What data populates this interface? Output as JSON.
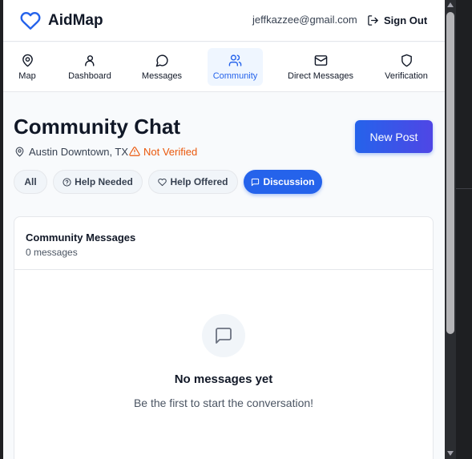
{
  "header": {
    "app_name": "AidMap",
    "user_email": "jeffkazzee@gmail.com",
    "sign_out_label": "Sign Out"
  },
  "nav": {
    "items": [
      {
        "label": "Map",
        "icon": "map-pin-icon"
      },
      {
        "label": "Dashboard",
        "icon": "user-icon"
      },
      {
        "label": "Messages",
        "icon": "message-circle-icon"
      },
      {
        "label": "Community",
        "icon": "users-icon",
        "active": true
      },
      {
        "label": "Direct Messages",
        "icon": "mail-icon"
      },
      {
        "label": "Verification",
        "icon": "shield-icon"
      }
    ]
  },
  "page": {
    "title": "Community Chat",
    "location": "Austin Downtown, TX",
    "verification_status": "Not Verified",
    "new_post_label": "New Post"
  },
  "filters": {
    "items": [
      {
        "label": "All"
      },
      {
        "label": "Help Needed",
        "icon": "help-circle-icon"
      },
      {
        "label": "Help Offered",
        "icon": "heart-icon"
      },
      {
        "label": "Discussion",
        "icon": "message-square-icon",
        "active": true
      }
    ]
  },
  "messages_card": {
    "title": "Community Messages",
    "count_text": "0 messages",
    "empty_title": "No messages yet",
    "empty_subtitle": "Be the first to start the conversation!"
  },
  "colors": {
    "accent": "#2563eb",
    "accent_gradient_end": "#4f46e5",
    "warning": "#ea580c",
    "text_primary": "#111827",
    "page_background": "#f8fafc"
  }
}
